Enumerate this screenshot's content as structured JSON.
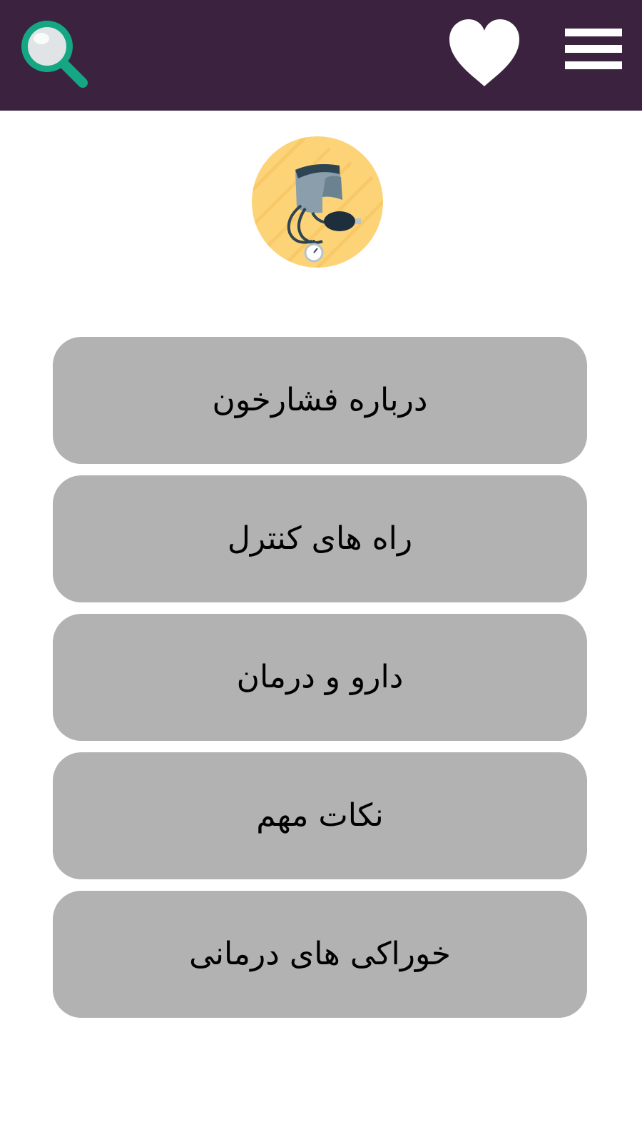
{
  "header": {
    "background_color": "#3b2340",
    "search_icon": "search-icon",
    "favorite_icon": "heart-icon",
    "menu_icon": "hamburger-menu-icon"
  },
  "logo": {
    "icon": "blood-pressure-monitor-icon",
    "circle_color": "#fdd377"
  },
  "menu": {
    "button_color": "#b2b2b2",
    "items": [
      {
        "label": "درباره فشارخون"
      },
      {
        "label": "راه های کنترل"
      },
      {
        "label": "دارو و درمان"
      },
      {
        "label": "نکات مهم"
      },
      {
        "label": "خوراکی های درمانی"
      }
    ]
  }
}
